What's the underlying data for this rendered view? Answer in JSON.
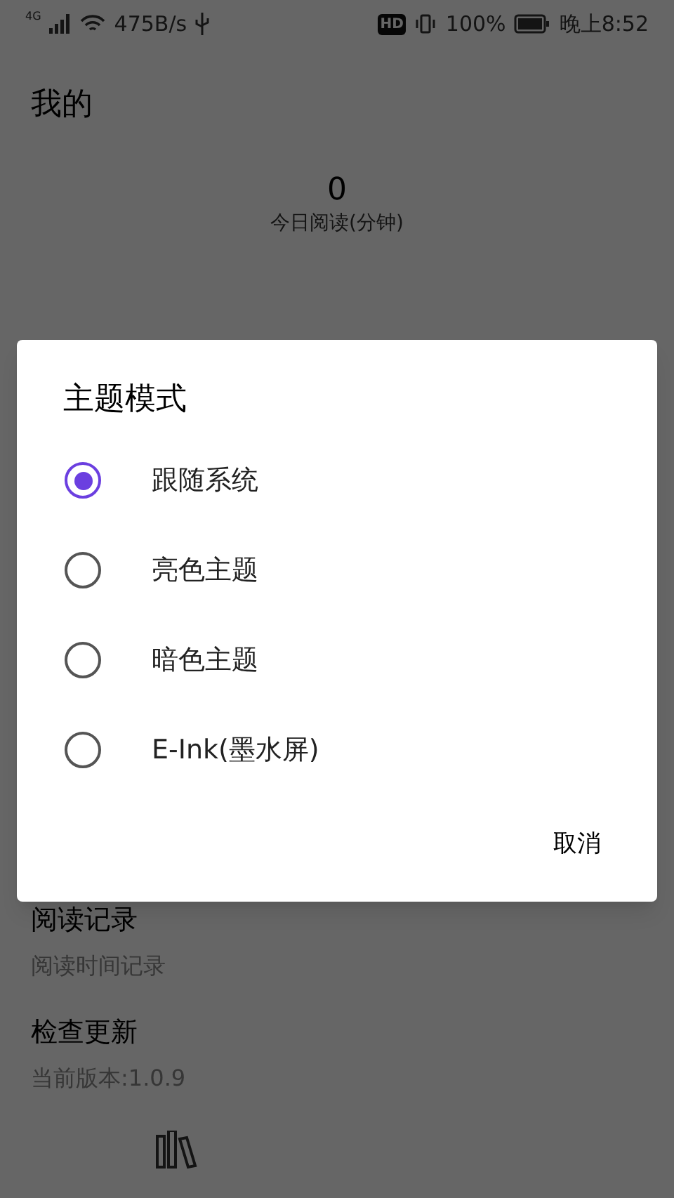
{
  "status_bar": {
    "network": "4G",
    "speed": "475B/s",
    "hd": "HD",
    "battery": "100%",
    "time": "晚上8:52"
  },
  "header": {
    "title": "我的"
  },
  "stats": {
    "value": "0",
    "label": "今日阅读(分钟)"
  },
  "settings": [
    {
      "title": "阅读记录",
      "subtitle": "阅读时间记录"
    },
    {
      "title": "检查更新",
      "subtitle": "当前版本:1.0.9"
    }
  ],
  "dialog": {
    "title": "主题模式",
    "options": [
      {
        "label": "跟随系统",
        "selected": true
      },
      {
        "label": "亮色主题",
        "selected": false
      },
      {
        "label": "暗色主题",
        "selected": false
      },
      {
        "label": "E-Ink(墨水屏)",
        "selected": false
      }
    ],
    "cancel": "取消"
  }
}
